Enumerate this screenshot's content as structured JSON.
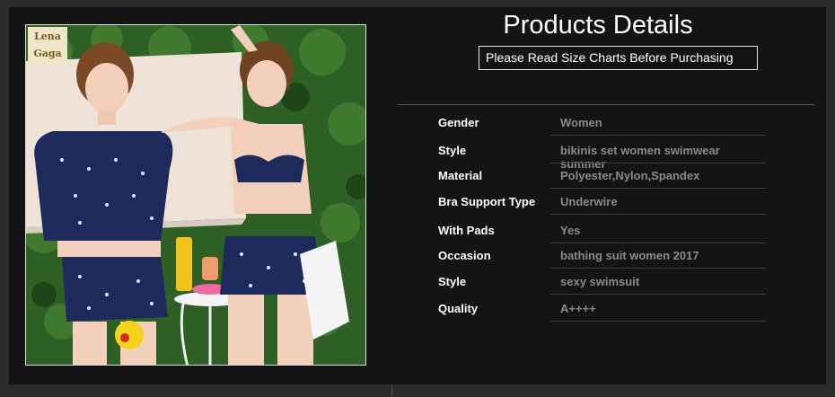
{
  "header": {
    "title": "Products Details",
    "notice": "Please Read Size Charts Before Purchasing"
  },
  "photo": {
    "logo_line1": "Lena",
    "logo_line2": "Gaga"
  },
  "specs": [
    {
      "label": "Gender",
      "value": "Women"
    },
    {
      "label": "Style",
      "value": "bikinis set women swimwear summer"
    },
    {
      "label": "Material",
      "value": "Polyester,Nylon,Spandex"
    },
    {
      "label": "Bra Support Type",
      "value": "Underwire"
    },
    {
      "label": "With Pads",
      "value": "Yes"
    },
    {
      "label": "Occasion",
      "value": "bathing suit women 2017"
    },
    {
      "label": "Style",
      "value": "sexy swimsuit"
    },
    {
      "label": "Quality",
      "value": "A++++"
    }
  ]
}
